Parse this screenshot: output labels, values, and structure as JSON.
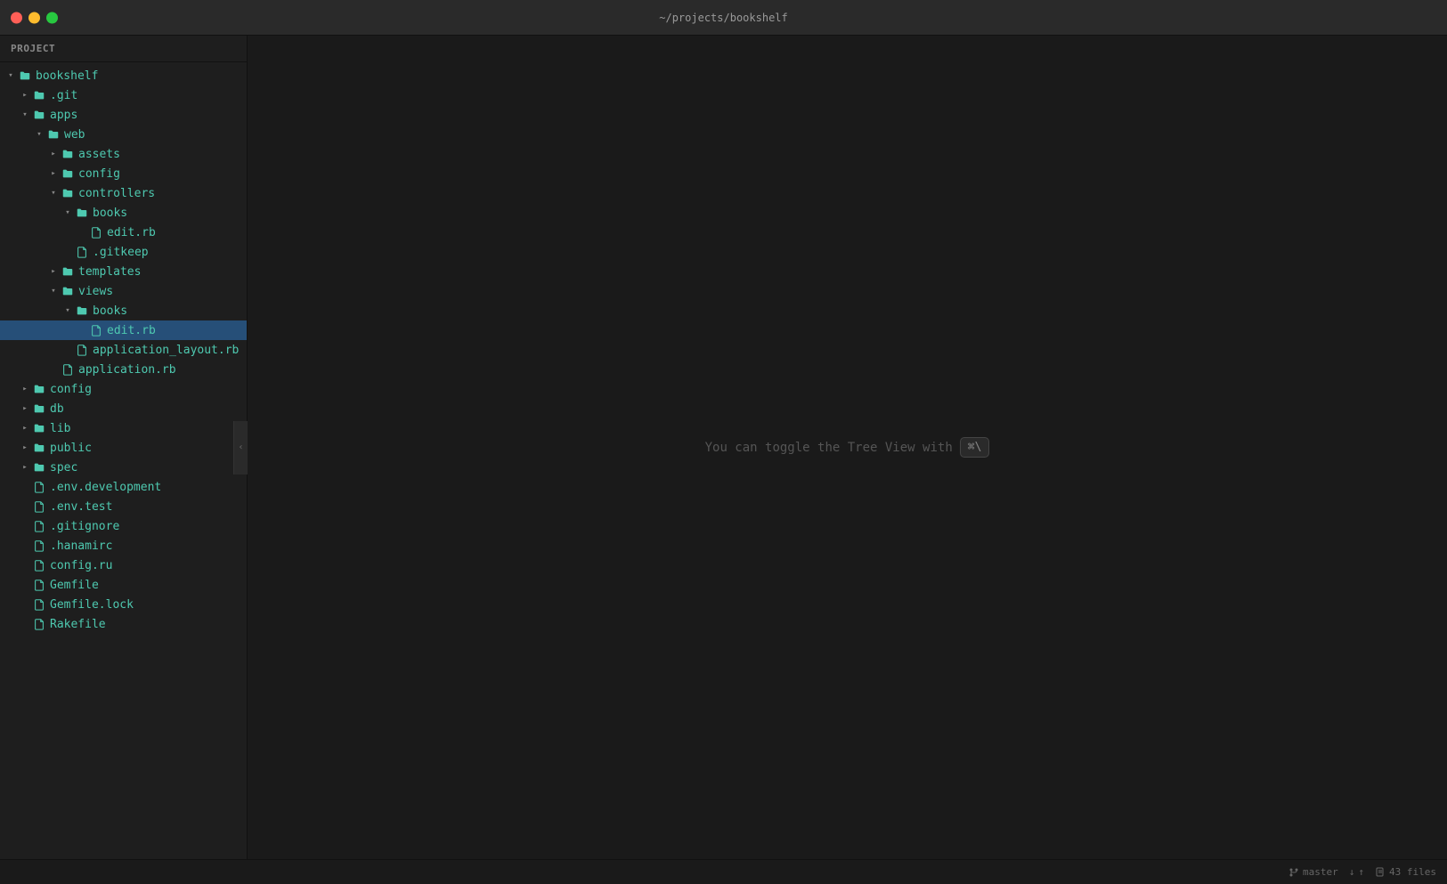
{
  "window": {
    "title": "~/projects/bookshelf",
    "project_label": "Project"
  },
  "traffic_lights": {
    "close_title": "Close",
    "min_title": "Minimize",
    "max_title": "Maximize"
  },
  "sidebar": {
    "header": "Project",
    "collapse_arrow": "‹"
  },
  "tree": [
    {
      "id": "bookshelf",
      "label": "bookshelf",
      "type": "folder",
      "depth": 0,
      "state": "open"
    },
    {
      "id": "git",
      "label": ".git",
      "type": "folder",
      "depth": 1,
      "state": "closed"
    },
    {
      "id": "apps",
      "label": "apps",
      "type": "folder",
      "depth": 1,
      "state": "open"
    },
    {
      "id": "web",
      "label": "web",
      "type": "folder",
      "depth": 2,
      "state": "open"
    },
    {
      "id": "assets",
      "label": "assets",
      "type": "folder",
      "depth": 3,
      "state": "closed"
    },
    {
      "id": "config-web",
      "label": "config",
      "type": "folder",
      "depth": 3,
      "state": "closed"
    },
    {
      "id": "controllers",
      "label": "controllers",
      "type": "folder",
      "depth": 3,
      "state": "open"
    },
    {
      "id": "books-ctrl",
      "label": "books",
      "type": "folder",
      "depth": 4,
      "state": "open"
    },
    {
      "id": "edit-rb-ctrl",
      "label": "edit.rb",
      "type": "file",
      "depth": 5,
      "state": null
    },
    {
      "id": "gitkeep",
      "label": ".gitkeep",
      "type": "file",
      "depth": 4,
      "state": null
    },
    {
      "id": "templates",
      "label": "templates",
      "type": "folder",
      "depth": 3,
      "state": "closed"
    },
    {
      "id": "views",
      "label": "views",
      "type": "folder",
      "depth": 3,
      "state": "open"
    },
    {
      "id": "books-views",
      "label": "books",
      "type": "folder",
      "depth": 4,
      "state": "open"
    },
    {
      "id": "edit-rb-views",
      "label": "edit.rb",
      "type": "file",
      "depth": 5,
      "state": null,
      "selected": true
    },
    {
      "id": "application-layout",
      "label": "application_layout.rb",
      "type": "file",
      "depth": 4,
      "state": null
    },
    {
      "id": "application-rb",
      "label": "application.rb",
      "type": "file",
      "depth": 3,
      "state": null
    },
    {
      "id": "config",
      "label": "config",
      "type": "folder",
      "depth": 1,
      "state": "closed"
    },
    {
      "id": "db",
      "label": "db",
      "type": "folder",
      "depth": 1,
      "state": "closed"
    },
    {
      "id": "lib",
      "label": "lib",
      "type": "folder",
      "depth": 1,
      "state": "closed"
    },
    {
      "id": "public",
      "label": "public",
      "type": "folder",
      "depth": 1,
      "state": "closed"
    },
    {
      "id": "spec",
      "label": "spec",
      "type": "folder",
      "depth": 1,
      "state": "closed"
    },
    {
      "id": "env-dev",
      "label": ".env.development",
      "type": "file-dot",
      "depth": 1,
      "state": null
    },
    {
      "id": "env-test",
      "label": ".env.test",
      "type": "file-dot",
      "depth": 1,
      "state": null
    },
    {
      "id": "gitignore",
      "label": ".gitignore",
      "type": "file-dot",
      "depth": 1,
      "state": null
    },
    {
      "id": "hanamirc",
      "label": ".hanamirc",
      "type": "file-dot",
      "depth": 1,
      "state": null
    },
    {
      "id": "config-ru",
      "label": "config.ru",
      "type": "file-dot",
      "depth": 1,
      "state": null
    },
    {
      "id": "gemfile",
      "label": "Gemfile",
      "type": "file-dot",
      "depth": 1,
      "state": null
    },
    {
      "id": "gemfile-lock",
      "label": "Gemfile.lock",
      "type": "file-dot",
      "depth": 1,
      "state": null
    },
    {
      "id": "rakefile",
      "label": "Rakefile",
      "type": "file-dot",
      "depth": 1,
      "state": null
    }
  ],
  "editor": {
    "toggle_hint": "You can toggle the Tree View with",
    "shortcut": "⌘\\"
  },
  "statusbar": {
    "branch": "master",
    "files_count": "43 files",
    "up_arrow": "↑",
    "down_arrow": "↓"
  }
}
